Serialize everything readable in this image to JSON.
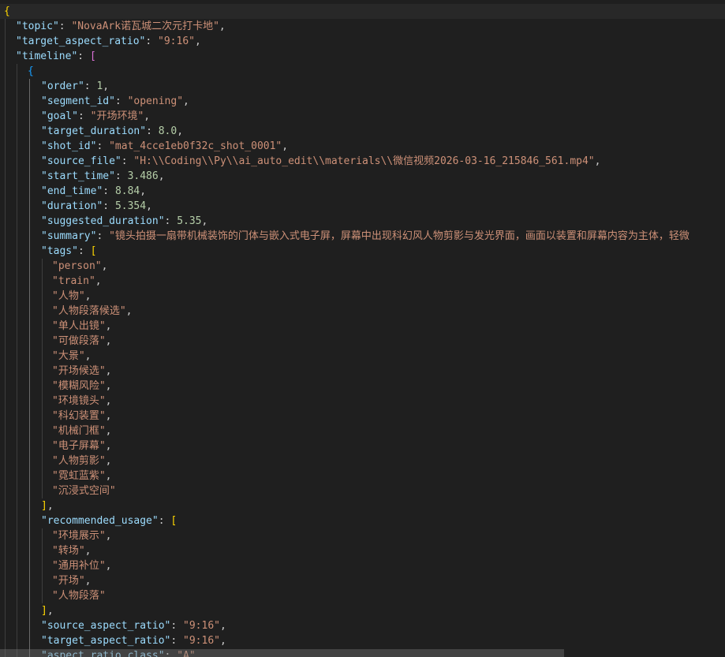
{
  "editor": {
    "language": "json",
    "colors": {
      "background": "#1f1f1f",
      "key": "#9cdcfe",
      "string": "#ce9178",
      "number": "#b5cea8",
      "punctuation": "#cccccc",
      "bracket_level1": "#ffd700",
      "bracket_level2": "#da70d6",
      "bracket_level3": "#179fff",
      "indent_guide": "#3e3e3e",
      "current_line": "#282828"
    },
    "lines": [
      {
        "depth": 0,
        "tokens": [
          [
            "b1",
            "{"
          ]
        ]
      },
      {
        "depth": 1,
        "tokens": [
          [
            "key",
            "\"topic\""
          ],
          [
            "pun",
            ": "
          ],
          [
            "str",
            "\"NovaArk诺瓦城二次元打卡地\""
          ],
          [
            "pun",
            ","
          ]
        ]
      },
      {
        "depth": 1,
        "tokens": [
          [
            "key",
            "\"target_aspect_ratio\""
          ],
          [
            "pun",
            ": "
          ],
          [
            "str",
            "\"9:16\""
          ],
          [
            "pun",
            ","
          ]
        ]
      },
      {
        "depth": 1,
        "tokens": [
          [
            "key",
            "\"timeline\""
          ],
          [
            "pun",
            ": "
          ],
          [
            "b2",
            "["
          ]
        ]
      },
      {
        "depth": 2,
        "tokens": [
          [
            "b3",
            "{"
          ]
        ]
      },
      {
        "depth": 3,
        "tokens": [
          [
            "key",
            "\"order\""
          ],
          [
            "pun",
            ": "
          ],
          [
            "num",
            "1"
          ],
          [
            "pun",
            ","
          ]
        ]
      },
      {
        "depth": 3,
        "tokens": [
          [
            "key",
            "\"segment_id\""
          ],
          [
            "pun",
            ": "
          ],
          [
            "str",
            "\"opening\""
          ],
          [
            "pun",
            ","
          ]
        ]
      },
      {
        "depth": 3,
        "tokens": [
          [
            "key",
            "\"goal\""
          ],
          [
            "pun",
            ": "
          ],
          [
            "str",
            "\"开场环境\""
          ],
          [
            "pun",
            ","
          ]
        ]
      },
      {
        "depth": 3,
        "tokens": [
          [
            "key",
            "\"target_duration\""
          ],
          [
            "pun",
            ": "
          ],
          [
            "num",
            "8.0"
          ],
          [
            "pun",
            ","
          ]
        ]
      },
      {
        "depth": 3,
        "tokens": [
          [
            "key",
            "\"shot_id\""
          ],
          [
            "pun",
            ": "
          ],
          [
            "str",
            "\"mat_4cce1eb0f32c_shot_0001\""
          ],
          [
            "pun",
            ","
          ]
        ]
      },
      {
        "depth": 3,
        "tokens": [
          [
            "key",
            "\"source_file\""
          ],
          [
            "pun",
            ": "
          ],
          [
            "str",
            "\"H:\\\\Coding\\\\Py\\\\ai_auto_edit\\\\materials\\\\微信视频2026-03-16_215846_561.mp4\""
          ],
          [
            "pun",
            ","
          ]
        ]
      },
      {
        "depth": 3,
        "tokens": [
          [
            "key",
            "\"start_time\""
          ],
          [
            "pun",
            ": "
          ],
          [
            "num",
            "3.486"
          ],
          [
            "pun",
            ","
          ]
        ]
      },
      {
        "depth": 3,
        "tokens": [
          [
            "key",
            "\"end_time\""
          ],
          [
            "pun",
            ": "
          ],
          [
            "num",
            "8.84"
          ],
          [
            "pun",
            ","
          ]
        ]
      },
      {
        "depth": 3,
        "tokens": [
          [
            "key",
            "\"duration\""
          ],
          [
            "pun",
            ": "
          ],
          [
            "num",
            "5.354"
          ],
          [
            "pun",
            ","
          ]
        ]
      },
      {
        "depth": 3,
        "tokens": [
          [
            "key",
            "\"suggested_duration\""
          ],
          [
            "pun",
            ": "
          ],
          [
            "num",
            "5.35"
          ],
          [
            "pun",
            ","
          ]
        ]
      },
      {
        "depth": 3,
        "tokens": [
          [
            "key",
            "\"summary\""
          ],
          [
            "pun",
            ": "
          ],
          [
            "str",
            "\"镜头拍摄一扇带机械装饰的门体与嵌入式电子屏，屏幕中出现科幻风人物剪影与发光界面，画面以装置和屏幕内容为主体，轻微"
          ]
        ]
      },
      {
        "depth": 3,
        "tokens": [
          [
            "key",
            "\"tags\""
          ],
          [
            "pun",
            ": "
          ],
          [
            "b1",
            "["
          ]
        ]
      },
      {
        "depth": 4,
        "tokens": [
          [
            "str",
            "\"person\""
          ],
          [
            "pun",
            ","
          ]
        ]
      },
      {
        "depth": 4,
        "tokens": [
          [
            "str",
            "\"train\""
          ],
          [
            "pun",
            ","
          ]
        ]
      },
      {
        "depth": 4,
        "tokens": [
          [
            "str",
            "\"人物\""
          ],
          [
            "pun",
            ","
          ]
        ]
      },
      {
        "depth": 4,
        "tokens": [
          [
            "str",
            "\"人物段落候选\""
          ],
          [
            "pun",
            ","
          ]
        ]
      },
      {
        "depth": 4,
        "tokens": [
          [
            "str",
            "\"单人出镜\""
          ],
          [
            "pun",
            ","
          ]
        ]
      },
      {
        "depth": 4,
        "tokens": [
          [
            "str",
            "\"可做段落\""
          ],
          [
            "pun",
            ","
          ]
        ]
      },
      {
        "depth": 4,
        "tokens": [
          [
            "str",
            "\"大景\""
          ],
          [
            "pun",
            ","
          ]
        ]
      },
      {
        "depth": 4,
        "tokens": [
          [
            "str",
            "\"开场候选\""
          ],
          [
            "pun",
            ","
          ]
        ]
      },
      {
        "depth": 4,
        "tokens": [
          [
            "str",
            "\"模糊风险\""
          ],
          [
            "pun",
            ","
          ]
        ]
      },
      {
        "depth": 4,
        "tokens": [
          [
            "str",
            "\"环境镜头\""
          ],
          [
            "pun",
            ","
          ]
        ]
      },
      {
        "depth": 4,
        "tokens": [
          [
            "str",
            "\"科幻装置\""
          ],
          [
            "pun",
            ","
          ]
        ]
      },
      {
        "depth": 4,
        "tokens": [
          [
            "str",
            "\"机械门框\""
          ],
          [
            "pun",
            ","
          ]
        ]
      },
      {
        "depth": 4,
        "tokens": [
          [
            "str",
            "\"电子屏幕\""
          ],
          [
            "pun",
            ","
          ]
        ]
      },
      {
        "depth": 4,
        "tokens": [
          [
            "str",
            "\"人物剪影\""
          ],
          [
            "pun",
            ","
          ]
        ]
      },
      {
        "depth": 4,
        "tokens": [
          [
            "str",
            "\"霓虹蓝紫\""
          ],
          [
            "pun",
            ","
          ]
        ]
      },
      {
        "depth": 4,
        "tokens": [
          [
            "str",
            "\"沉浸式空间\""
          ]
        ]
      },
      {
        "depth": 3,
        "tokens": [
          [
            "b1",
            "]"
          ],
          [
            "pun",
            ","
          ]
        ]
      },
      {
        "depth": 3,
        "tokens": [
          [
            "key",
            "\"recommended_usage\""
          ],
          [
            "pun",
            ": "
          ],
          [
            "b1",
            "["
          ]
        ]
      },
      {
        "depth": 4,
        "tokens": [
          [
            "str",
            "\"环境展示\""
          ],
          [
            "pun",
            ","
          ]
        ]
      },
      {
        "depth": 4,
        "tokens": [
          [
            "str",
            "\"转场\""
          ],
          [
            "pun",
            ","
          ]
        ]
      },
      {
        "depth": 4,
        "tokens": [
          [
            "str",
            "\"通用补位\""
          ],
          [
            "pun",
            ","
          ]
        ]
      },
      {
        "depth": 4,
        "tokens": [
          [
            "str",
            "\"开场\""
          ],
          [
            "pun",
            ","
          ]
        ]
      },
      {
        "depth": 4,
        "tokens": [
          [
            "str",
            "\"人物段落\""
          ]
        ]
      },
      {
        "depth": 3,
        "tokens": [
          [
            "b1",
            "]"
          ],
          [
            "pun",
            ","
          ]
        ]
      },
      {
        "depth": 3,
        "tokens": [
          [
            "key",
            "\"source_aspect_ratio\""
          ],
          [
            "pun",
            ": "
          ],
          [
            "str",
            "\"9:16\""
          ],
          [
            "pun",
            ","
          ]
        ]
      },
      {
        "depth": 3,
        "tokens": [
          [
            "key",
            "\"target_aspect_ratio\""
          ],
          [
            "pun",
            ": "
          ],
          [
            "str",
            "\"9:16\""
          ],
          [
            "pun",
            ","
          ]
        ]
      },
      {
        "depth": 3,
        "tokens": [
          [
            "key",
            "\"aspect_ratio_class\""
          ],
          [
            "pun",
            ": "
          ],
          [
            "str",
            "\"A\""
          ]
        ]
      }
    ]
  }
}
